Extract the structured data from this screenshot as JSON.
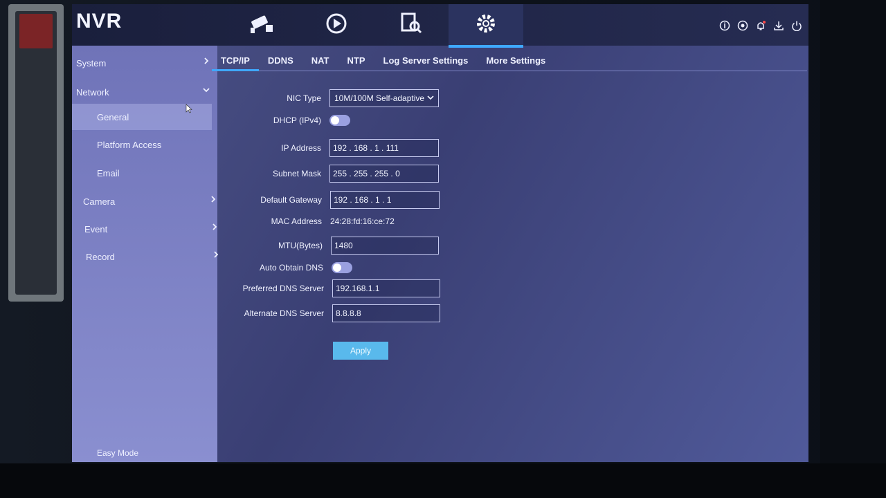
{
  "app": {
    "title": "NVR"
  },
  "top_nav": [
    {
      "icon": "camera-icon"
    },
    {
      "icon": "playback-icon"
    },
    {
      "icon": "search-doc-icon"
    },
    {
      "icon": "gear-icon",
      "active": true
    }
  ],
  "top_right_icons": [
    "info-icon",
    "record-icon",
    "bell-icon",
    "download-icon",
    "power-icon"
  ],
  "sidebar": {
    "items": [
      {
        "label": "System",
        "chevron": "right"
      },
      {
        "label": "Network",
        "chevron": "down"
      },
      {
        "label": "General",
        "sub": true,
        "active": true
      },
      {
        "label": "Platform Access",
        "sub": true
      },
      {
        "label": "Email",
        "sub": true
      },
      {
        "label": "Camera",
        "chevron": "right"
      },
      {
        "label": "Event",
        "chevron": "right"
      },
      {
        "label": "Record",
        "chevron": "right"
      }
    ],
    "easy_mode": "Easy Mode"
  },
  "tabs": [
    "TCP/IP",
    "DDNS",
    "NAT",
    "NTP",
    "Log Server Settings",
    "More Settings"
  ],
  "active_tab": "TCP/IP",
  "form": {
    "nic_type": {
      "label": "NIC Type",
      "value": "10M/100M Self-adaptive"
    },
    "dhcp": {
      "label": "DHCP (IPv4)",
      "enabled": false
    },
    "ip_address": {
      "label": "IP Address",
      "value": "192 . 168 . 1    . 111"
    },
    "subnet_mask": {
      "label": "Subnet Mask",
      "value": "255 . 255 . 255 . 0"
    },
    "default_gateway": {
      "label": "Default Gateway",
      "value": "192 . 168 . 1    . 1"
    },
    "mac_address": {
      "label": "MAC Address",
      "value": "24:28:fd:16:ce:72"
    },
    "mtu": {
      "label": "MTU(Bytes)",
      "value": "1480"
    },
    "auto_obtain_dns": {
      "label": "Auto Obtain DNS",
      "enabled": false
    },
    "preferred_dns": {
      "label": "Preferred DNS Server",
      "value": "192.168.1.1"
    },
    "alternate_dns": {
      "label": "Alternate DNS Server",
      "value": "8.8.8.8"
    },
    "apply_label": "Apply"
  },
  "colors": {
    "accent": "#3fa8ff",
    "apply": "#59b9ec"
  }
}
